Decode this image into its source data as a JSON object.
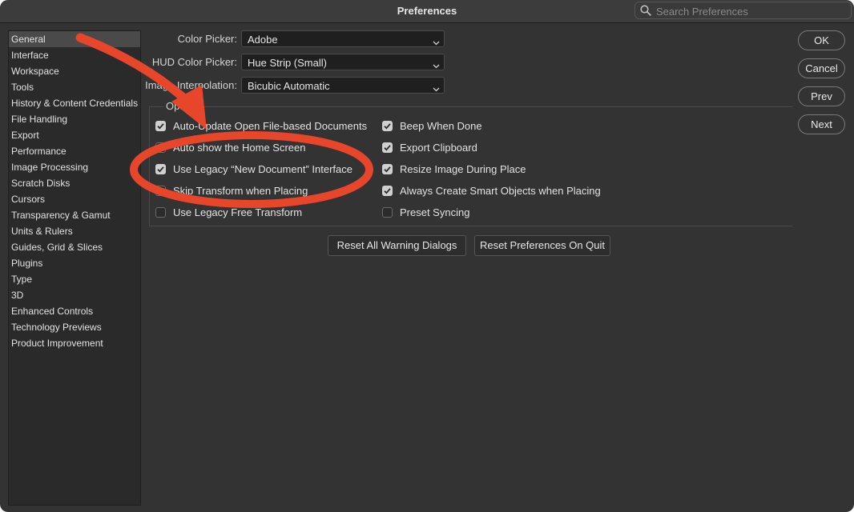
{
  "window": {
    "title": "Preferences"
  },
  "search": {
    "placeholder": "Search Preferences",
    "icon": "search-icon"
  },
  "sidebar": {
    "items": [
      {
        "label": "General",
        "selected": true
      },
      {
        "label": "Interface"
      },
      {
        "label": "Workspace"
      },
      {
        "label": "Tools"
      },
      {
        "label": "History & Content Credentials"
      },
      {
        "label": "File Handling"
      },
      {
        "label": "Export"
      },
      {
        "label": "Performance"
      },
      {
        "label": "Image Processing"
      },
      {
        "label": "Scratch Disks"
      },
      {
        "label": "Cursors"
      },
      {
        "label": "Transparency & Gamut"
      },
      {
        "label": "Units & Rulers"
      },
      {
        "label": "Guides, Grid & Slices"
      },
      {
        "label": "Plugins"
      },
      {
        "label": "Type"
      },
      {
        "label": "3D"
      },
      {
        "label": "Enhanced Controls"
      },
      {
        "label": "Technology Previews"
      },
      {
        "label": "Product Improvement"
      }
    ]
  },
  "fields": {
    "color_picker": {
      "label": "Color Picker:",
      "value": "Adobe"
    },
    "hud_color_picker": {
      "label": "HUD Color Picker:",
      "value": "Hue Strip (Small)"
    },
    "image_interpolation": {
      "label": "Image Interpolation:",
      "value": "Bicubic Automatic"
    }
  },
  "options": {
    "legend": "Options",
    "left": [
      {
        "label": "Auto-Update Open File-based Documents",
        "checked": true
      },
      {
        "label": "Auto show the Home Screen",
        "checked": false
      },
      {
        "label": "Use Legacy “New Document” Interface",
        "checked": true
      },
      {
        "label": "Skip Transform when Placing",
        "checked": false
      },
      {
        "label": "Use Legacy Free Transform",
        "checked": false
      }
    ],
    "right": [
      {
        "label": "Beep When Done",
        "checked": true
      },
      {
        "label": "Export Clipboard",
        "checked": true
      },
      {
        "label": "Resize Image During Place",
        "checked": true
      },
      {
        "label": "Always Create Smart Objects when Placing",
        "checked": true
      },
      {
        "label": "Preset Syncing",
        "checked": false
      }
    ]
  },
  "buttons": {
    "reset_warnings": "Reset All Warning Dialogs",
    "reset_prefs": "Reset Preferences On Quit",
    "ok": "OK",
    "cancel": "Cancel",
    "prev": "Prev",
    "next": "Next"
  },
  "colors": {
    "annotation": "#e8462a",
    "background": "#333333"
  }
}
